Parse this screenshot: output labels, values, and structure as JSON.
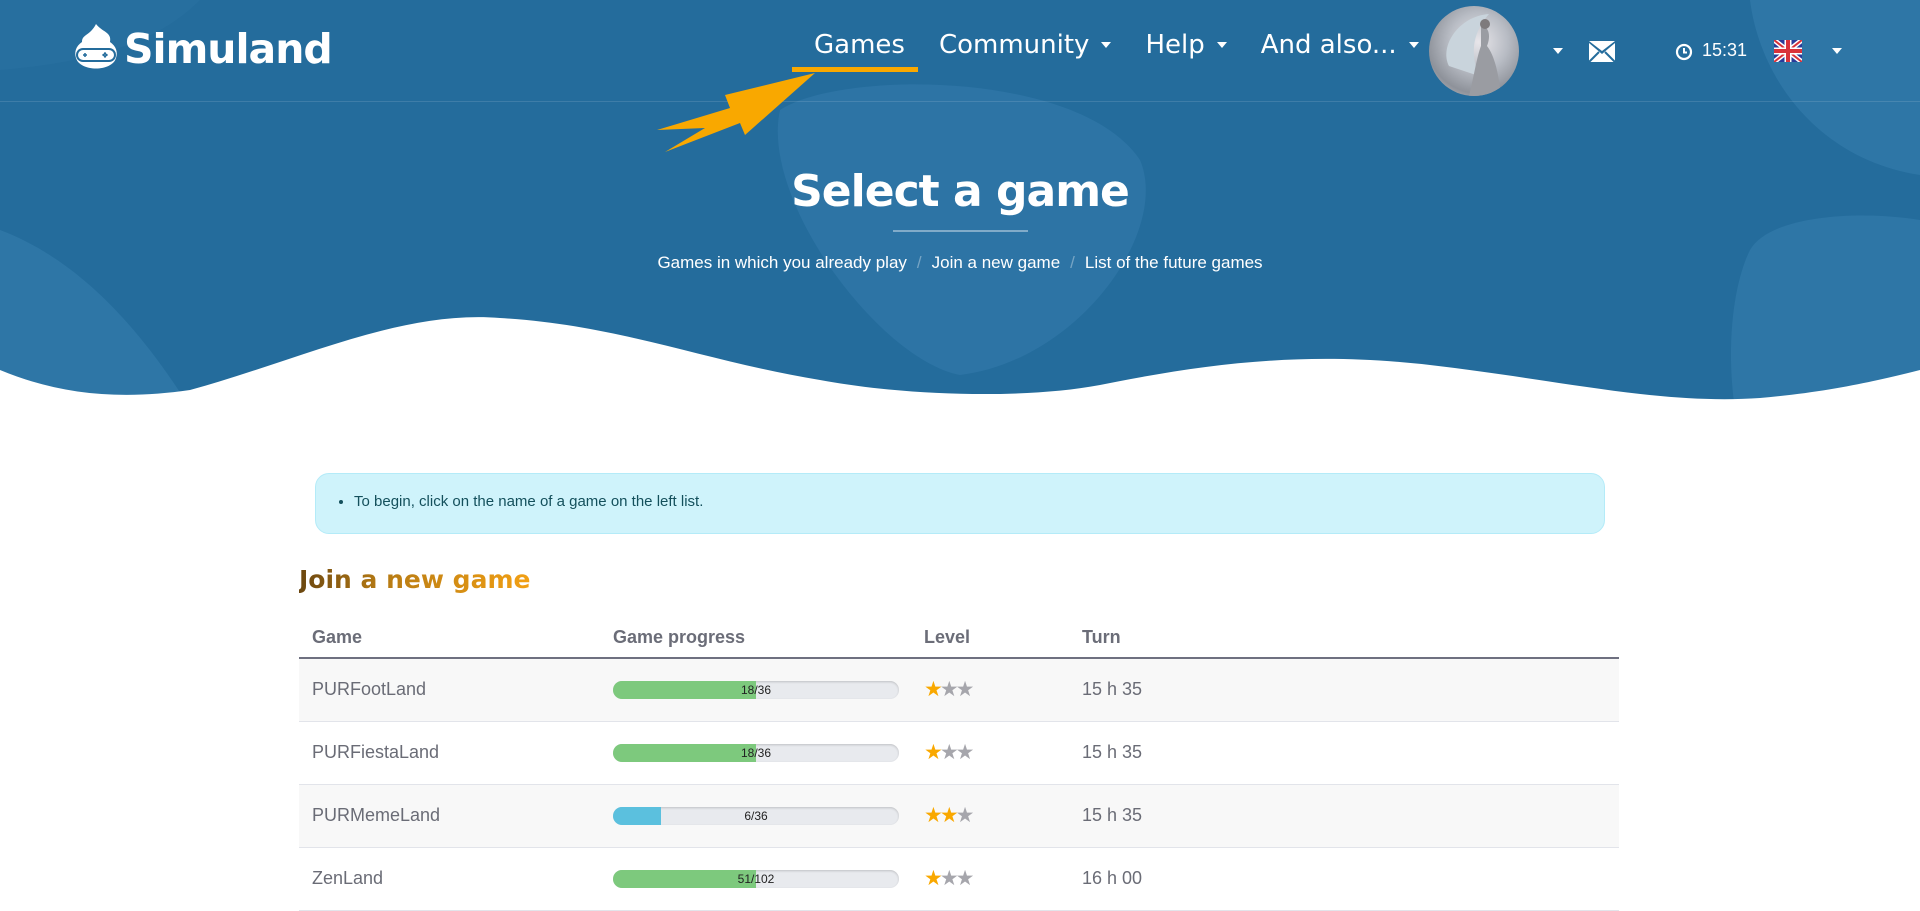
{
  "brand": {
    "name": "Simuland",
    "icon": "gamepad-mascot-icon"
  },
  "nav": {
    "items": [
      {
        "label": "Games",
        "dropdown": false,
        "active": true
      },
      {
        "label": "Community",
        "dropdown": true
      },
      {
        "label": "Help",
        "dropdown": true
      },
      {
        "label": "And also...",
        "dropdown": true
      }
    ],
    "time": "15:31",
    "language_flag": "uk-flag-icon"
  },
  "colors": {
    "header_bg": "#246c9c",
    "accent": "#f9a800",
    "progress_green": "#7dc97d",
    "progress_blue": "#5bc0de",
    "alert_bg": "#cff3fb"
  },
  "page": {
    "title": "Select a game",
    "breadcrumb": [
      {
        "label": "Games in which you already play"
      },
      {
        "label": "Join a new game"
      },
      {
        "label": "List of the future games"
      }
    ]
  },
  "alert": {
    "text": "To begin, click on the name of a game on the left list."
  },
  "section": {
    "title": "Join a new game"
  },
  "table": {
    "headers": [
      "Game",
      "Game progress",
      "Level",
      "Turn"
    ],
    "rows": [
      {
        "game": "PURFootLand",
        "progress": "18/36",
        "progress_value": 18,
        "progress_max": 36,
        "progress_color": "green",
        "level": 1,
        "level_max": 3,
        "turn": "15 h 35"
      },
      {
        "game": "PURFiestaLand",
        "progress": "18/36",
        "progress_value": 18,
        "progress_max": 36,
        "progress_color": "green",
        "level": 1,
        "level_max": 3,
        "turn": "15 h 35"
      },
      {
        "game": "PURMemeLand",
        "progress": "6/36",
        "progress_value": 6,
        "progress_max": 36,
        "progress_color": "blue",
        "level": 2,
        "level_max": 3,
        "turn": "15 h 35"
      },
      {
        "game": "ZenLand",
        "progress": "51/102",
        "progress_value": 51,
        "progress_max": 102,
        "progress_color": "green",
        "level": 1,
        "level_max": 3,
        "turn": "16 h 00"
      }
    ]
  }
}
